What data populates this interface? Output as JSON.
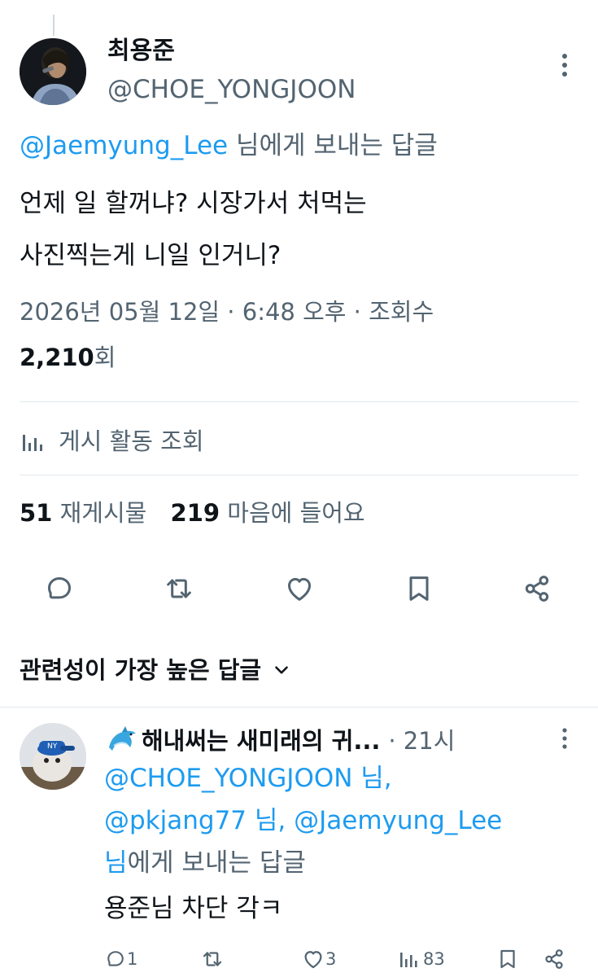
{
  "main_post": {
    "author": {
      "display_name": "최용준",
      "handle": "@CHOE_YONGJOON"
    },
    "reply_to": {
      "mention": "@Jaemyung_Lee",
      "suffix": " 님에게 보내는 답글"
    },
    "text_line1": "언제 일 할꺼냐? 시장가서 처먹는",
    "text_line2": "사진찍는게 니일 인거니?",
    "meta_line": "2026년 05월 12일 · 6:48 오후 · 조회수",
    "views_count": "2,210",
    "views_suffix": "회",
    "activity_label": "게시 활동 조회",
    "reposts_count": "51",
    "reposts_label": "재게시물",
    "likes_count": "219",
    "likes_label": "마음에 들어요"
  },
  "sort": {
    "label": "관련성이 가장 높은 답글"
  },
  "reply": {
    "author": {
      "display_name": "해내써는 새미래의 귀...",
      "time": "· 21시"
    },
    "reply_to": {
      "mention1": "@CHOE_YONGJOON",
      "suffix1": " 님,",
      "mention2": "@pkjang77",
      "suffix2": " 님, ",
      "mention3": "@Jaemyung_Lee",
      "mention4": "님",
      "suffix3": "에게 보내는 답글"
    },
    "text": "용준님 차단 각ㅋ",
    "stats": {
      "replies": "1",
      "likes": "3",
      "views": "83"
    }
  },
  "colors": {
    "accent": "#1d9bf0",
    "text": "#0f1419",
    "secondary": "#536471",
    "divider": "#e1e8ed"
  },
  "icons": [
    "more-icon",
    "analytics-icon",
    "reply-icon",
    "repost-icon",
    "like-icon",
    "bookmark-icon",
    "share-icon",
    "chevron-down-icon",
    "dolphin-icon"
  ]
}
